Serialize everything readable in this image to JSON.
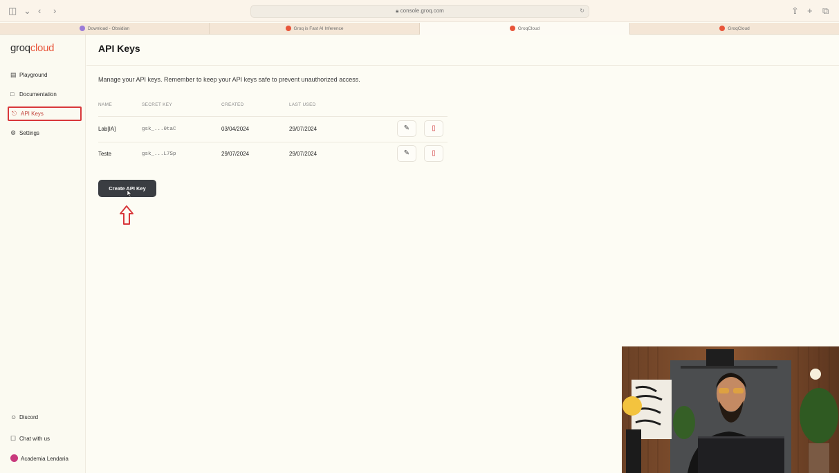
{
  "browser": {
    "url": "console.groq.com",
    "tabs": [
      {
        "title": "Download - Obsidian",
        "color": "#9b7bd8"
      },
      {
        "title": "Groq is Fast AI Inference",
        "color": "#e8553a"
      },
      {
        "title": "GroqCloud",
        "color": "#e8553a"
      },
      {
        "title": "GroqCloud",
        "color": "#e8553a"
      }
    ]
  },
  "sidebar": {
    "logo_part1": "groq",
    "logo_part2": "cloud",
    "items": [
      {
        "label": "Playground",
        "icon": "playground-icon"
      },
      {
        "label": "Documentation",
        "icon": "book-icon"
      },
      {
        "label": "API Keys",
        "icon": "lock-icon",
        "active": true
      },
      {
        "label": "Settings",
        "icon": "gear-icon"
      }
    ],
    "bottom": [
      {
        "label": "Discord",
        "icon": "discord-icon"
      },
      {
        "label": "Chat with us",
        "icon": "chat-icon"
      }
    ],
    "user": "Academia Lendaria"
  },
  "main": {
    "title": "API Keys",
    "description": "Manage your API keys. Remember to keep your API keys safe to prevent unauthorized access.",
    "table": {
      "headers": [
        "NAME",
        "SECRET KEY",
        "CREATED",
        "LAST USED"
      ],
      "rows": [
        {
          "name": "Lab[IA]",
          "key": "gsk_...0taC",
          "created": "03/04/2024",
          "last_used": "29/07/2024"
        },
        {
          "name": "Teste",
          "key": "gsk_...L7Sp",
          "created": "29/07/2024",
          "last_used": "29/07/2024"
        }
      ]
    },
    "create_button": "Create API Key"
  },
  "colors": {
    "accent": "#e8553a",
    "active_border": "#d8373a",
    "button_bg": "#3a3d42"
  }
}
